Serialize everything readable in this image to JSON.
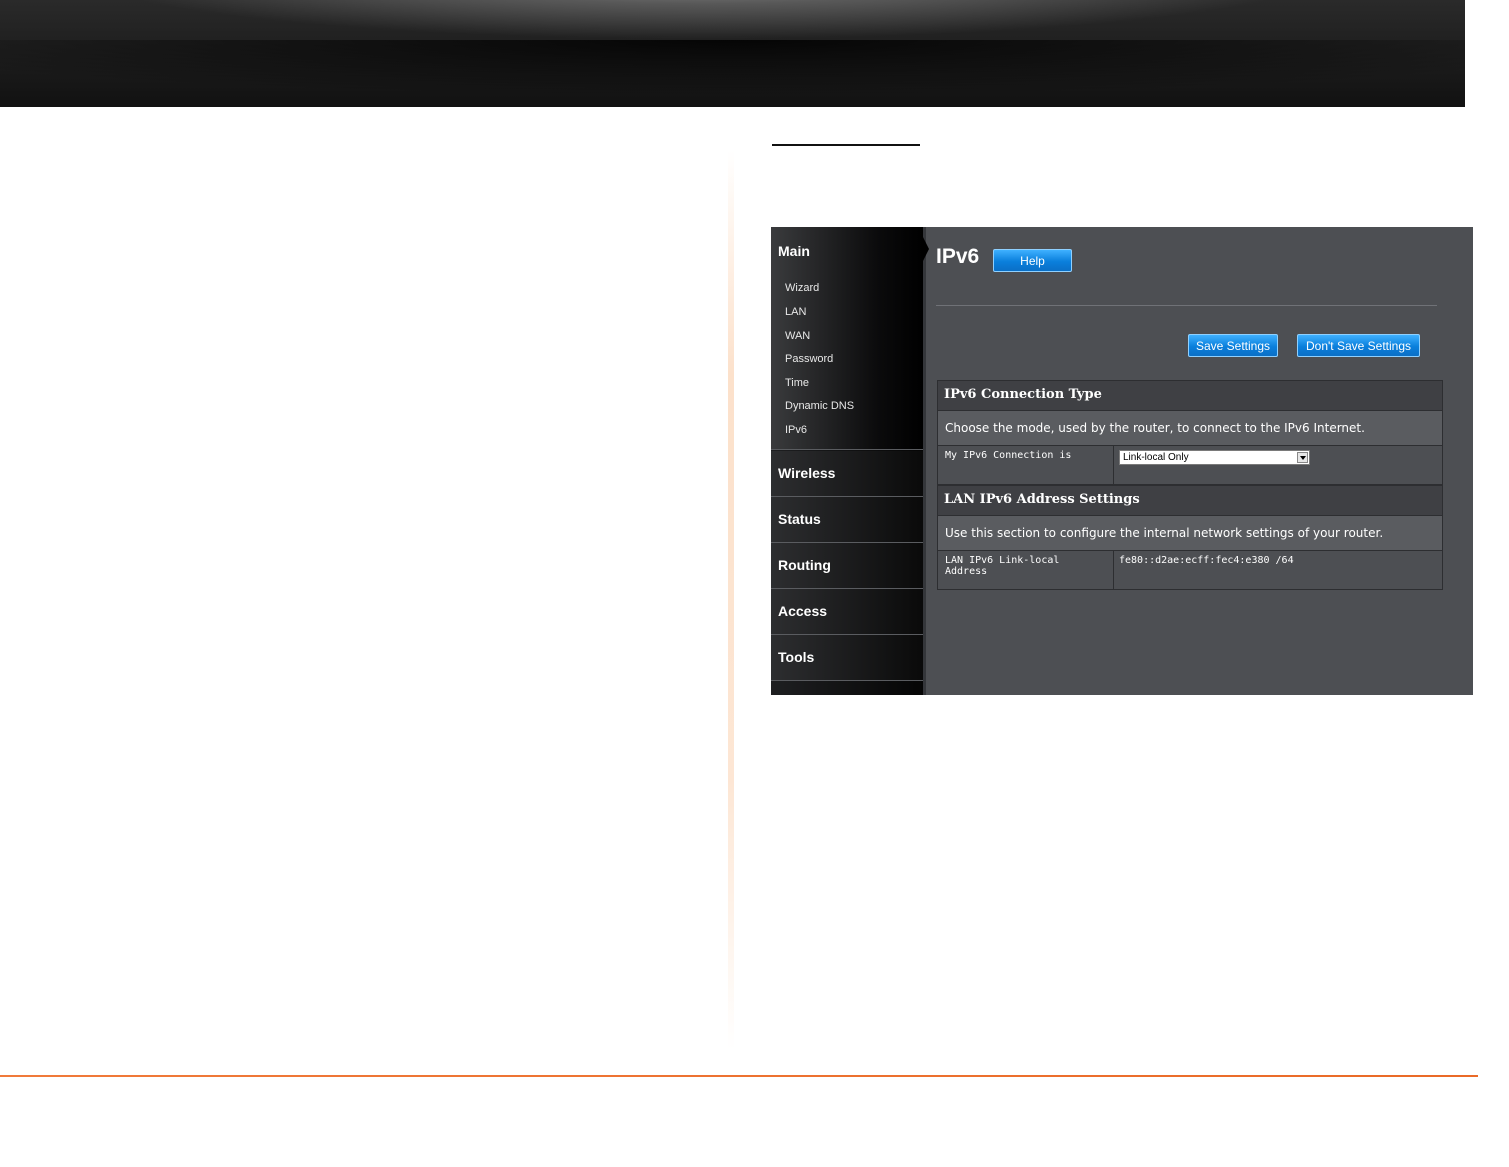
{
  "ui": {
    "sidebar": {
      "main_title": "Main",
      "main_items": [
        "Wizard",
        "LAN",
        "WAN",
        "Password",
        "Time",
        "Dynamic DNS",
        "IPv6"
      ],
      "sections": [
        "Wireless",
        "Status",
        "Routing",
        "Access",
        "Tools"
      ]
    },
    "page_title": "IPv6",
    "help_label": "Help",
    "save_label": "Save Settings",
    "dont_save_label": "Don't Save Settings",
    "connection_type": {
      "heading": "IPv6 Connection Type",
      "description": "Choose the mode, used by the router, to connect to the IPv6 Internet.",
      "field_label": "My IPv6 Connection is",
      "field_value": "Link-local Only"
    },
    "lan_settings": {
      "heading": "LAN IPv6 Address Settings",
      "description": "Use this section to configure the internal network settings of your router.",
      "field_label": "LAN IPv6 Link-local Address",
      "field_value": "fe80::d2ae:ecff:fec4:e380 /64"
    }
  },
  "colors": {
    "accent_orange": "#ea6a27",
    "button_blue": "#0a7fdc",
    "panel_gray": "#4d4f53"
  }
}
